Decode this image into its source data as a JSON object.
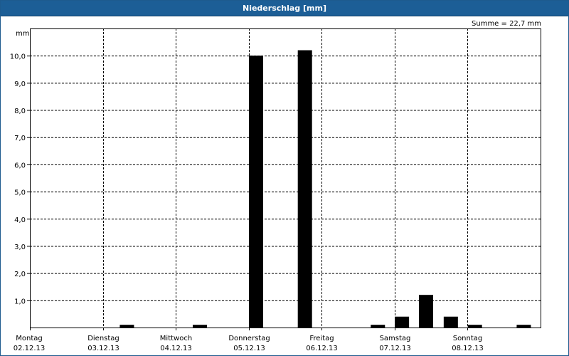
{
  "window": {
    "title": "Niederschlag [mm]"
  },
  "chart_data": {
    "type": "bar",
    "title": "Niederschlag [mm]",
    "ylabel": "mm",
    "ylim": [
      0,
      11
    ],
    "yticks": [
      1.0,
      2.0,
      3.0,
      4.0,
      5.0,
      6.0,
      7.0,
      8.0,
      9.0,
      10.0
    ],
    "ytick_labels": [
      "1,0",
      "2,0",
      "3,0",
      "4,0",
      "5,0",
      "6,0",
      "7,0",
      "8,0",
      "9,0",
      "10,0"
    ],
    "xlim": [
      0,
      7
    ],
    "grid": true,
    "sum_label": "Summe = 22,7 mm",
    "days": [
      {
        "name": "Montag",
        "date": "02.12.13"
      },
      {
        "name": "Dienstag",
        "date": "03.12.13"
      },
      {
        "name": "Mittwoch",
        "date": "04.12.13"
      },
      {
        "name": "Donnerstag",
        "date": "05.12.13"
      },
      {
        "name": "Freitag",
        "date": "06.12.13"
      },
      {
        "name": "Samstag",
        "date": "07.12.13"
      },
      {
        "name": "Sonntag",
        "date": "08.12.13"
      }
    ],
    "bars": [
      {
        "t": 1.33,
        "value": 0.1
      },
      {
        "t": 2.33,
        "value": 0.1
      },
      {
        "t": 3.1,
        "value": 10.0
      },
      {
        "t": 3.77,
        "value": 10.2
      },
      {
        "t": 4.77,
        "value": 0.1
      },
      {
        "t": 5.1,
        "value": 0.4
      },
      {
        "t": 5.43,
        "value": 1.2
      },
      {
        "t": 5.77,
        "value": 0.4
      },
      {
        "t": 6.1,
        "value": 0.1
      },
      {
        "t": 6.77,
        "value": 0.1
      }
    ]
  }
}
